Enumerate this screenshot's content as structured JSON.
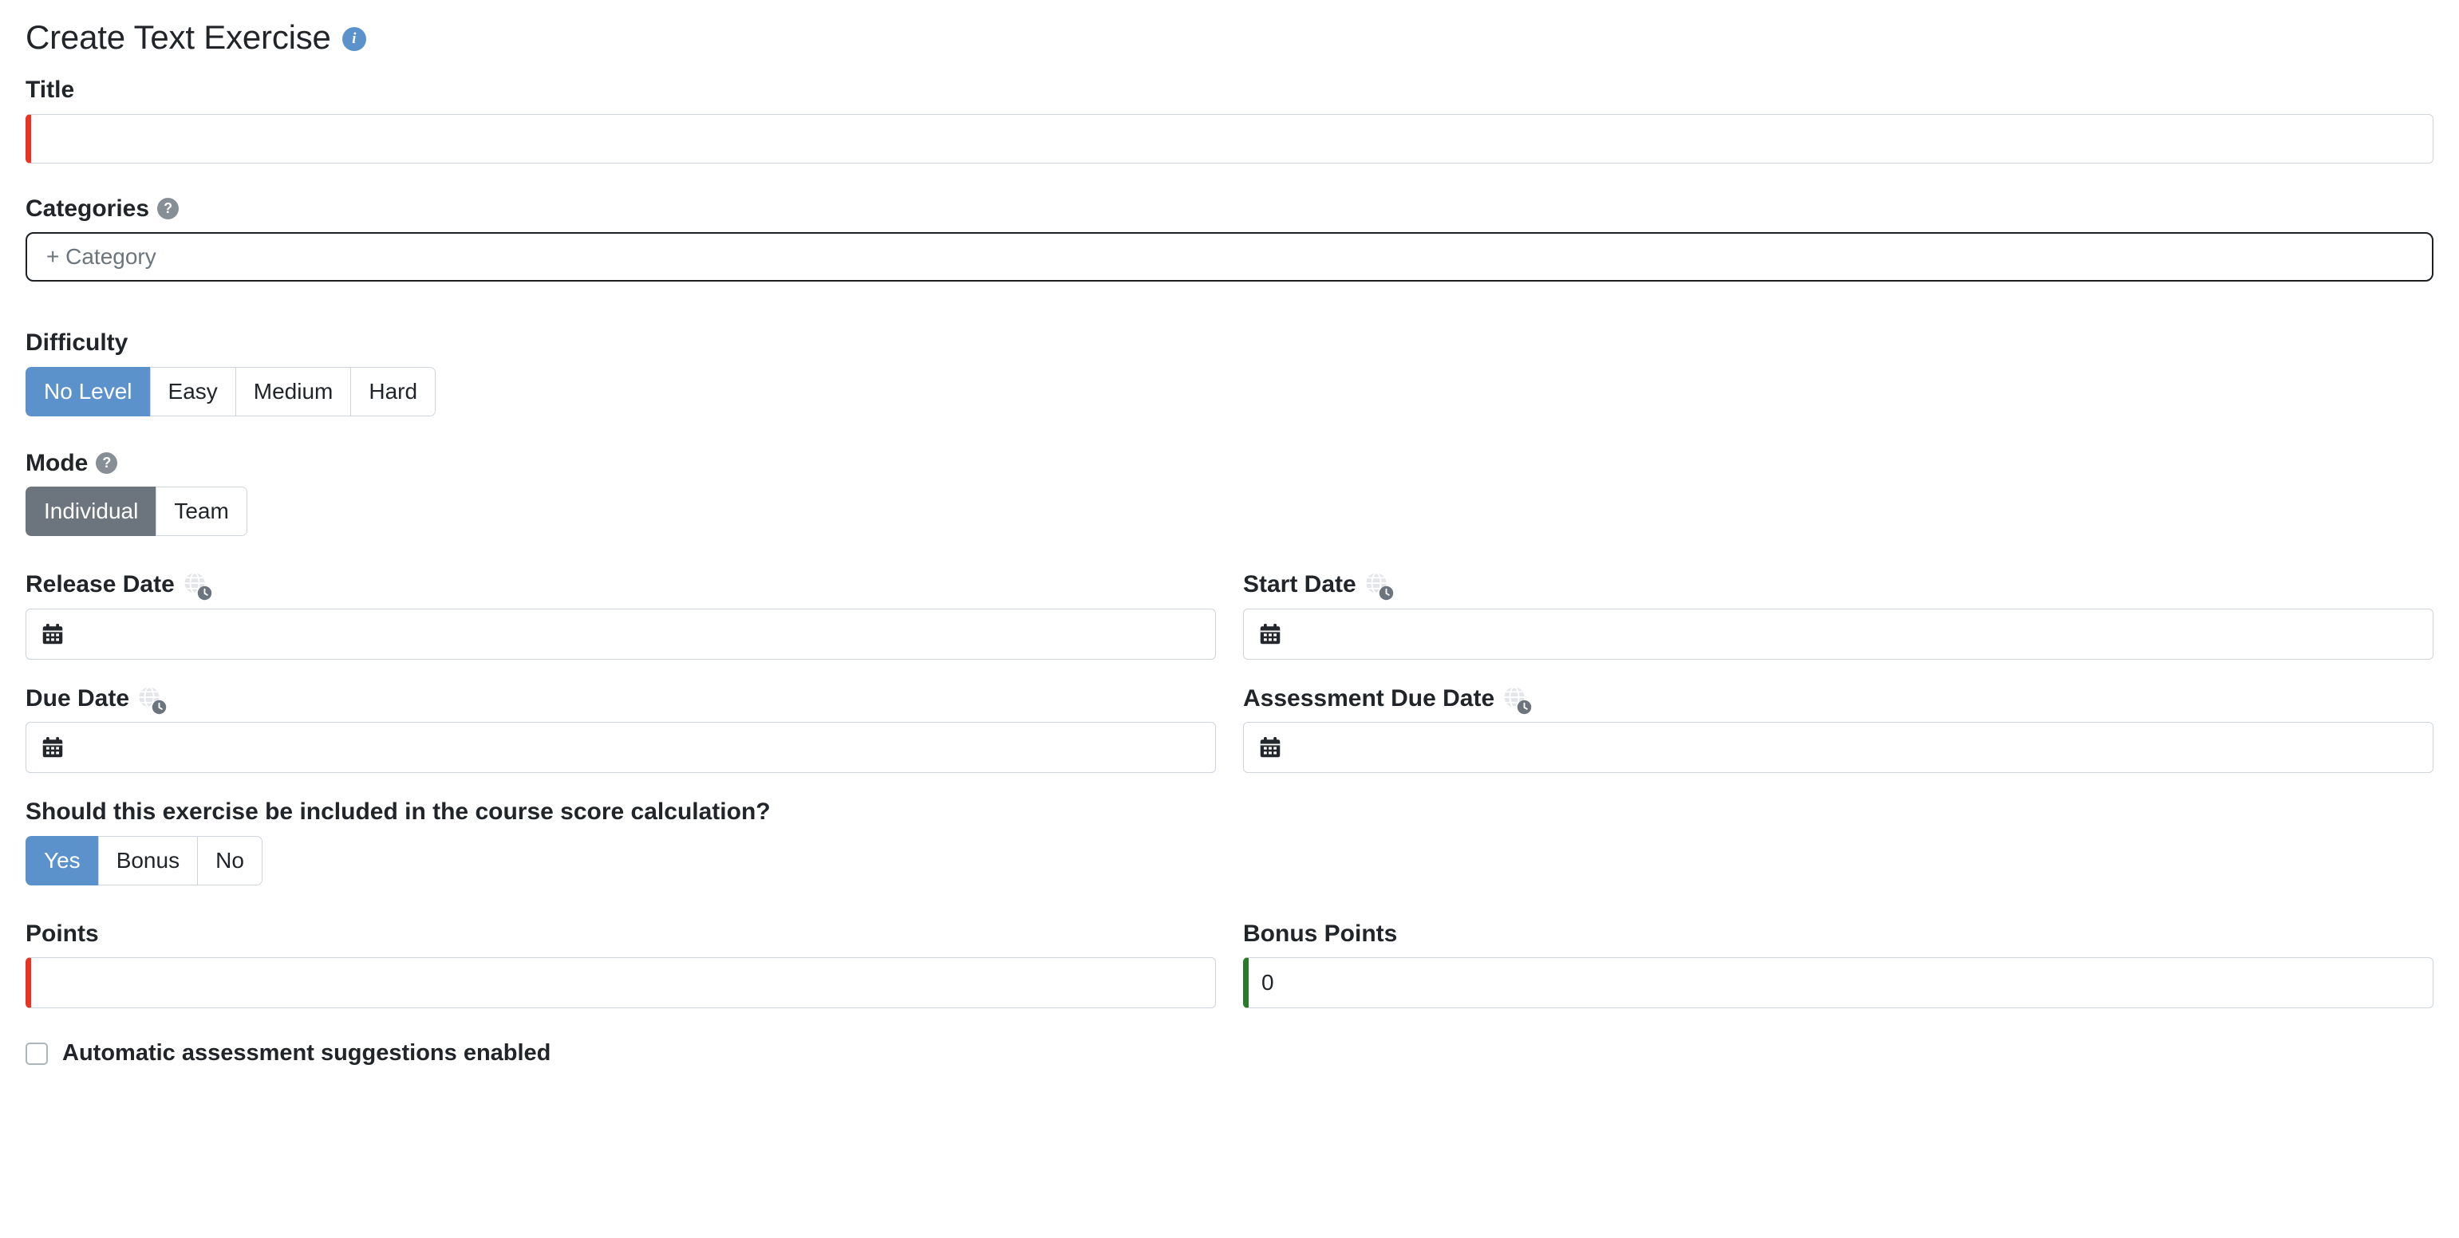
{
  "header": {
    "title": "Create Text Exercise",
    "info_icon": "info-icon",
    "info_glyph": "i"
  },
  "icons": {
    "help_glyph": "?",
    "help_icon": "help-icon",
    "calendar_icon": "calendar-icon",
    "timezone_icon": "globe-clock-icon"
  },
  "colors": {
    "accent_blue": "#5b92cc",
    "selected_gray": "#6c757d",
    "invalid_red": "#eb3323",
    "valid_green": "#2b7a2b",
    "border_gray": "#ced4da",
    "text_dark": "#212529",
    "placeholder_gray": "#6c757d"
  },
  "form": {
    "title": {
      "label": "Title",
      "value": "",
      "placeholder": "",
      "state": "invalid"
    },
    "categories": {
      "label": "Categories",
      "placeholder": "+ Category",
      "value": ""
    },
    "difficulty": {
      "label": "Difficulty",
      "options": [
        {
          "label": "No Level",
          "selected": true
        },
        {
          "label": "Easy",
          "selected": false
        },
        {
          "label": "Medium",
          "selected": false
        },
        {
          "label": "Hard",
          "selected": false
        }
      ]
    },
    "mode": {
      "label": "Mode",
      "options": [
        {
          "label": "Individual",
          "selected": true
        },
        {
          "label": "Team",
          "selected": false
        }
      ]
    },
    "release_date": {
      "label": "Release Date",
      "value": "",
      "placeholder": ""
    },
    "start_date": {
      "label": "Start Date",
      "value": "",
      "placeholder": ""
    },
    "due_date": {
      "label": "Due Date",
      "value": "",
      "placeholder": ""
    },
    "assessment_due_date": {
      "label": "Assessment Due Date",
      "value": "",
      "placeholder": ""
    },
    "included_in_score": {
      "label": "Should this exercise be included in the course score calculation?",
      "options": [
        {
          "label": "Yes",
          "selected": true
        },
        {
          "label": "Bonus",
          "selected": false
        },
        {
          "label": "No",
          "selected": false
        }
      ]
    },
    "points": {
      "label": "Points",
      "value": "",
      "placeholder": "",
      "state": "invalid"
    },
    "bonus_points": {
      "label": "Bonus Points",
      "value": "0",
      "placeholder": "",
      "state": "valid"
    },
    "automatic_assessment": {
      "label": "Automatic assessment suggestions enabled",
      "checked": false
    }
  }
}
